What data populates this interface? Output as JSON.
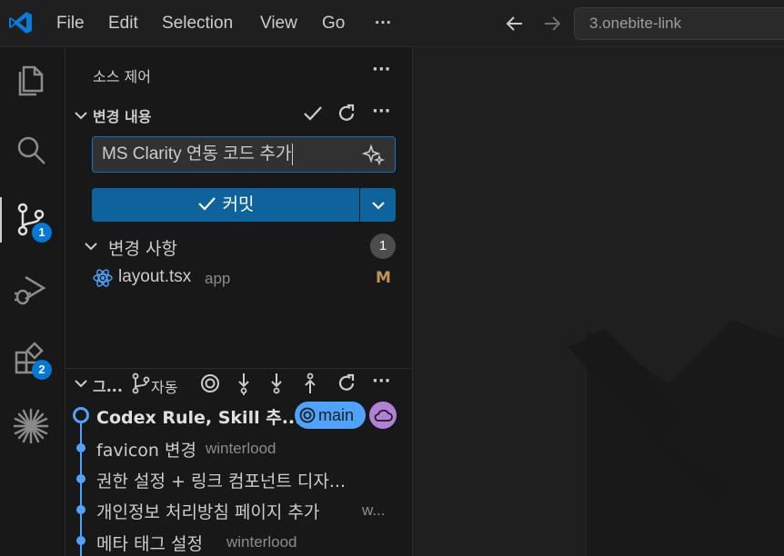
{
  "menubar": {
    "file": "File",
    "edit": "Edit",
    "selection": "Selection",
    "view": "View",
    "go": "Go",
    "more": "···"
  },
  "search": {
    "text": "3.onebite-link"
  },
  "activity": {
    "scm_badge": "1",
    "extensions_badge": "2"
  },
  "sidebar": {
    "title": "소스 제어",
    "changes_section": "변경 내용",
    "commit_message": "MS Clarity 연동 코드 추가",
    "commit_button": "커밋",
    "changes_group": "변경 사항",
    "changes_count": "1",
    "file": {
      "name": "layout.tsx",
      "dir": "app",
      "status": "M"
    },
    "graph_section": "그...",
    "graph_auto": "자동",
    "commits": [
      {
        "message": "Codex Rule, Skill 추...",
        "author": ""
      },
      {
        "message": "favicon 변경",
        "author": "winterlood"
      },
      {
        "message": "권한 설정 + 링크 컴포넌트 디자...",
        "author": ""
      },
      {
        "message": "개인정보 처리방침 페이지 추가",
        "author": "w..."
      },
      {
        "message": "메타 태그 설정",
        "author": "winterlood"
      }
    ],
    "branch_tag": "main"
  },
  "colors": {
    "accent": "#0078d4",
    "commit_button": "#0e639c",
    "graph": "#4fa3ff",
    "modified": "#c09553",
    "remote_tag": "#b180d7"
  }
}
